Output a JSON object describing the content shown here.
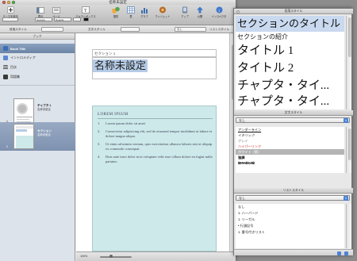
{
  "window": {
    "title": "名称未設定"
  },
  "toolbar": {
    "buttons": [
      {
        "label": "テーマを追加"
      },
      {
        "label": "表示"
      },
      {
        "label": "ページ"
      },
      {
        "label": "テキストボックス"
      },
      {
        "label": "図形"
      },
      {
        "label": "表"
      },
      {
        "label": "グラフ"
      },
      {
        "label": "ウィジェット"
      },
      {
        "label": "アップ"
      },
      {
        "label": "公開"
      },
      {
        "label": "インスペクタ"
      }
    ],
    "font_value": "Georgia",
    "style_value": "Regular"
  },
  "formatbar": {
    "paragraph_style": "段落スタイル",
    "character_style": "文字スタイル",
    "list_style": "リストスタイル",
    "list_popup": "なし"
  },
  "sidebar": {
    "header": "ブック",
    "nav": [
      {
        "label": "Book Title",
        "icon": "book-icon",
        "color": "#3d6fb8"
      },
      {
        "label": "イントロメディア",
        "icon": "media-icon",
        "color": "#5b8ad1"
      },
      {
        "label": "目次",
        "icon": "toc-icon",
        "color": "#4a4a4a"
      },
      {
        "label": "用語集",
        "icon": "glossary-icon",
        "color": "#3a3a3a"
      }
    ],
    "pages": [
      {
        "number": "1",
        "title": "チャプタ 1",
        "subtitle": "名称未設定"
      },
      {
        "number": "2",
        "title": "セクション",
        "subtitle": "名称未設定"
      }
    ]
  },
  "canvas": {
    "section_label": "セクション 1",
    "title": "名称未設定",
    "lorem_title": "LOREM IPSUM",
    "lorem_items": [
      {
        "num": "1.",
        "text": "Lorem ipsum dolor sit amet"
      },
      {
        "num": "2.",
        "text": "Consectetur adipisicing elit, sed do eiusmod tempor incididunt ut labore et dolore magna aliqua."
      },
      {
        "num": "3.",
        "text": "Ut enim ad minim veniam, quis exercitation ullamco laboris nisi ut aliquip ex commodo consequat."
      },
      {
        "num": "4.",
        "text": "Duis aute irure dolor in in voluptate velit esse cillum dolore eu fugiat nulla pariatur."
      }
    ]
  },
  "status": {
    "zoom": "100%",
    "zoom_fraction": 0.36
  },
  "style_palette": {
    "paragraph_header": "段落スタイル",
    "paragraph_styles": [
      {
        "label": "セクションのタイトル",
        "size": 13
      },
      {
        "label": "セクションの紹介",
        "size": 8
      },
      {
        "label": "タイトル 1",
        "size": 15
      },
      {
        "label": "タイトル 2",
        "size": 15
      },
      {
        "label": "チャプタ・タイ...",
        "size": 15
      },
      {
        "label": "チャプタ・タイ...",
        "size": 15
      }
    ],
    "character_popup": "なし",
    "character_header": "文字スタイル",
    "character_styles": [
      {
        "label": "アンダーライン",
        "color": "#111111",
        "deco": "underline"
      },
      {
        "label": "イタリック",
        "color": "#222222",
        "deco": "italic"
      },
      {
        "label": "グレイ",
        "color": "#777777",
        "deco": "none"
      },
      {
        "label": "ハイパーリンク",
        "color": "#c0242a",
        "deco": "none"
      },
      {
        "label": "ホワイト（影）",
        "color": "#ffffff",
        "deco": "none"
      },
      {
        "label": "強調",
        "color": "#111111",
        "deco": "bold"
      },
      {
        "label": "取り消し線",
        "color": "#111111",
        "deco": "strike"
      }
    ],
    "list_popup": "なし",
    "list_header": "リストスタイル",
    "list_styles": [
      {
        "label": "なし"
      },
      {
        "label": "1. ハーバード"
      },
      {
        "label": "1. リーガル"
      },
      {
        "label": "• 行頭記号"
      },
      {
        "label": "1. 番号付きリスト"
      }
    ]
  }
}
